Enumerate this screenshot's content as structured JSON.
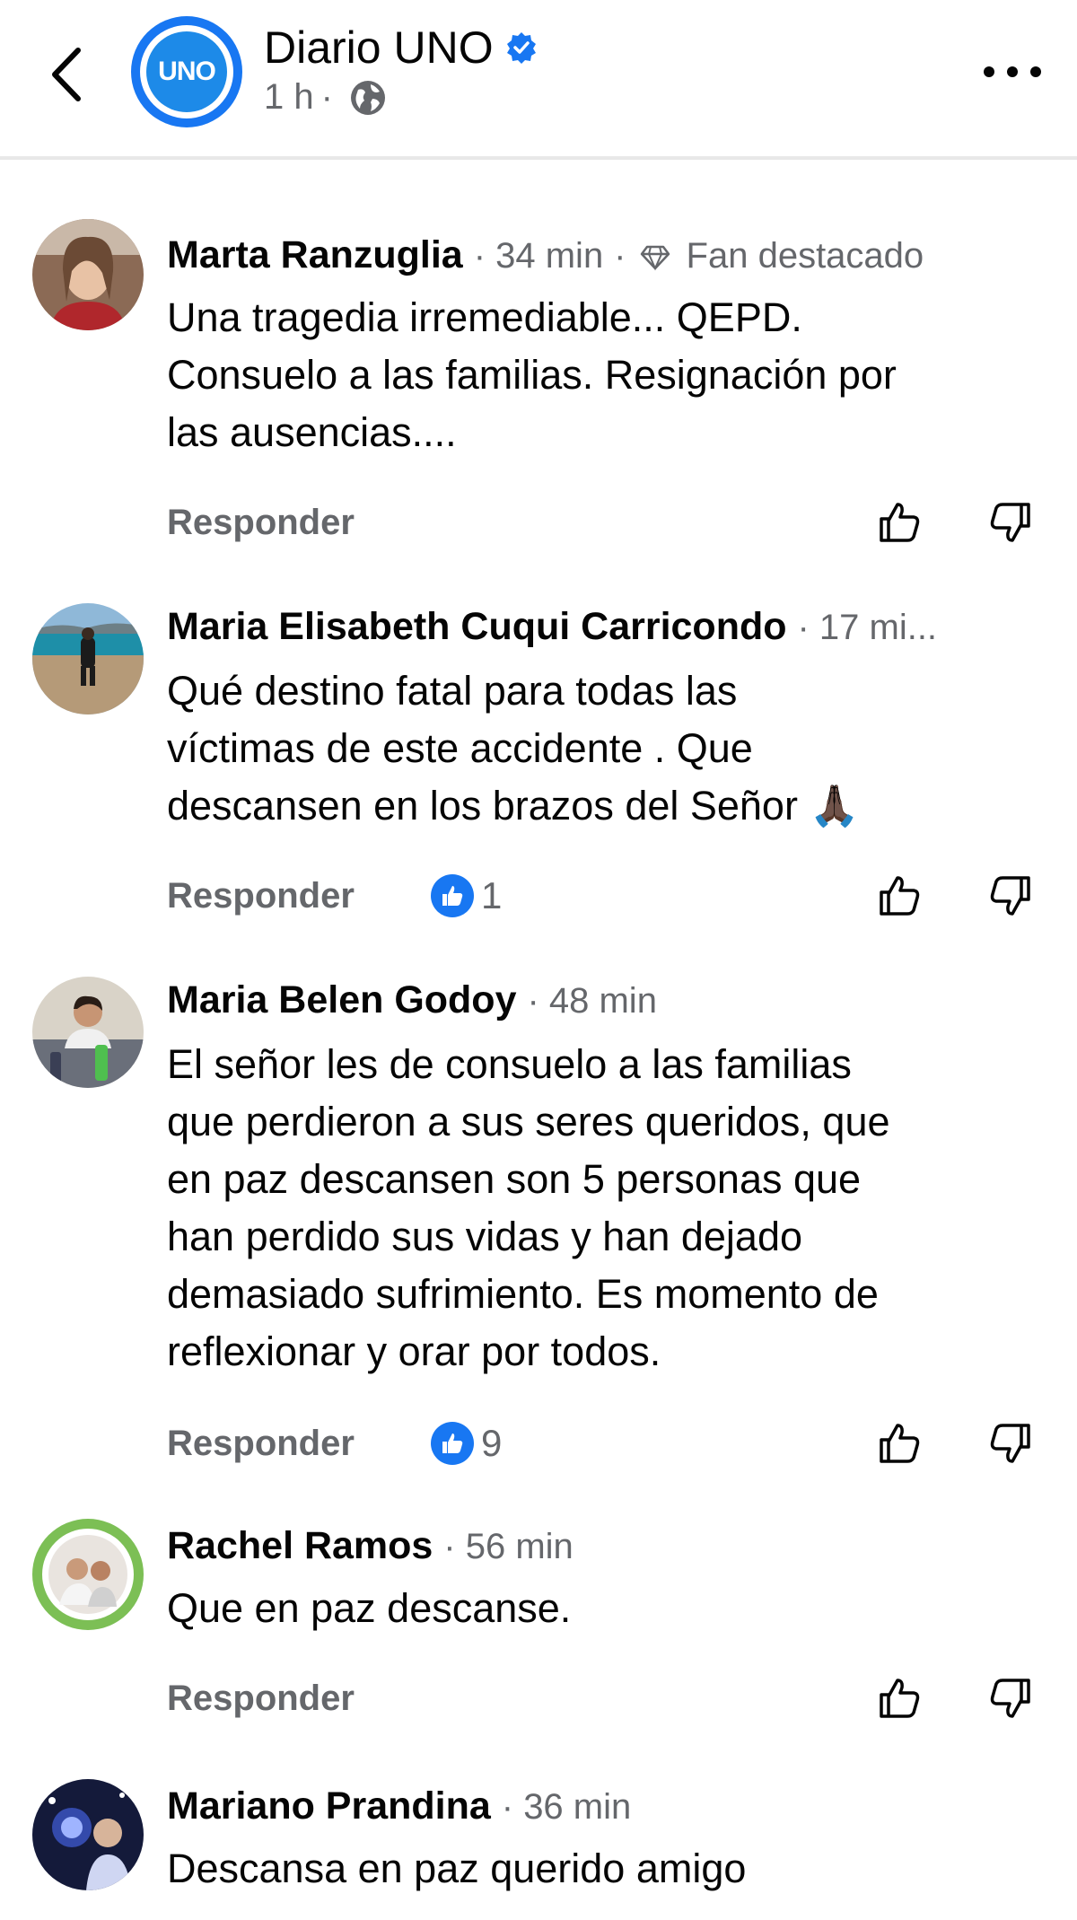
{
  "header": {
    "page_name": "Diario UNO",
    "avatar_text": "UNO",
    "time": "1 h",
    "separator": "·"
  },
  "comments": [
    {
      "author": "Marta Ranzuglia",
      "time": "34 min",
      "badge": "Fan destacado",
      "text_lines": [
        "Una tragedia irremediable... QEPD.",
        "Consuelo a las familias. Resignación por",
        "las ausencias...."
      ],
      "reply_label": "Responder",
      "reaction_count": ""
    },
    {
      "author": "Maria Elisabeth Cuqui Carricondo",
      "time": "17 mi...",
      "text_lines": [
        "Qué destino fatal para todas las",
        "víctimas de este accidente . Que",
        "descansen en los brazos del  Señor 🙏🏿"
      ],
      "reply_label": "Responder",
      "reaction_count": "1"
    },
    {
      "author": "Maria Belen Godoy",
      "time": "48 min",
      "text_lines": [
        "El señor les de consuelo a las familias",
        "que perdieron a sus seres queridos, que",
        "en paz descansen son 5 personas que",
        "han perdido sus vidas y han dejado",
        "demasiado sufrimiento. Es momento de",
        "reflexionar y orar por todos."
      ],
      "reply_label": "Responder",
      "reaction_count": "9"
    },
    {
      "author": "Rachel Ramos",
      "time": "56 min",
      "text_lines": [
        "Que en paz descanse."
      ],
      "reply_label": "Responder",
      "reaction_count": ""
    },
    {
      "author": "Mariano Prandina",
      "time": "36 min",
      "text_lines": [
        "Descansa en paz querido amigo"
      ],
      "reply_label": "",
      "reaction_count": ""
    }
  ],
  "icons": {
    "back": "chevron-left-icon",
    "verified": "verified-badge-icon",
    "globe": "globe-icon",
    "more": "more-horizontal-icon",
    "like": "thumbs-up-icon",
    "dislike": "thumbs-down-icon",
    "fan": "diamond-icon"
  },
  "colors": {
    "brand": "#1877f2",
    "secondary_text": "#65676b",
    "primary_text": "#050505"
  }
}
